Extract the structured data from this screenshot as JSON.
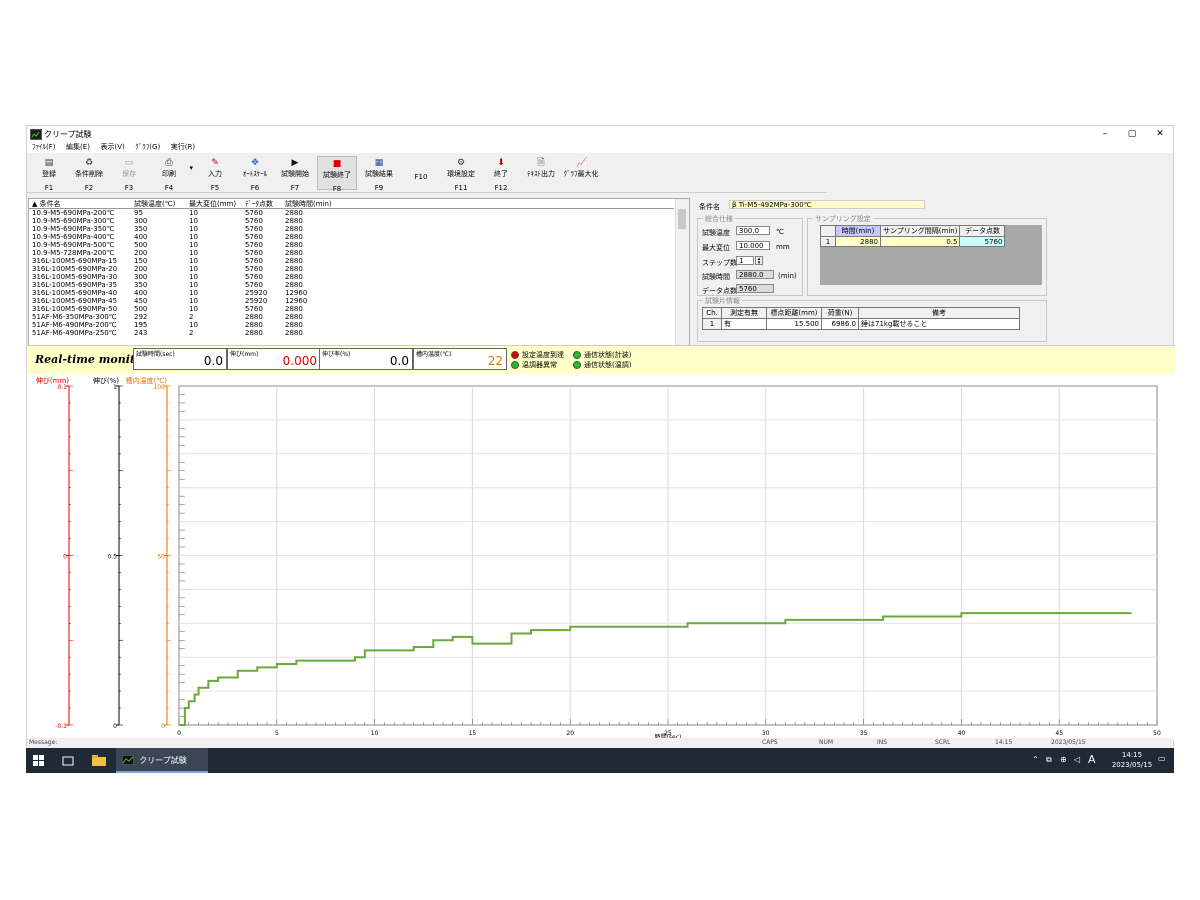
{
  "window": {
    "title": "クリープ試験",
    "minimize": "–",
    "maximize": "▢",
    "close": "✕"
  },
  "menu": [
    "ﾌｧｲﾙ(F)",
    "編集(E)",
    "表示(V)",
    "ｸﾞﾗﾌ(G)",
    "実行(R)"
  ],
  "toolbar": [
    {
      "label": "登録",
      "key": "F1",
      "icon": "register-icon",
      "glyph": "▤",
      "color": "#333333"
    },
    {
      "label": "条件削除",
      "key": "F2",
      "icon": "delete-icon",
      "glyph": "♻",
      "color": "#444444"
    },
    {
      "label": "保存",
      "key": "F3",
      "icon": "save-icon",
      "glyph": "▭",
      "color": "#999999",
      "disabled": true
    },
    {
      "label": "印刷",
      "key": "F4",
      "icon": "print-icon",
      "glyph": "⎙",
      "color": "#333333",
      "dropdown": true
    },
    {
      "label": "入力",
      "key": "F5",
      "icon": "pen-icon",
      "glyph": "✎",
      "color": "#c00000"
    },
    {
      "label": "ｵｰﾄｽｹｰﾙ",
      "key": "F6",
      "icon": "autoscale-icon",
      "glyph": "✥",
      "color": "#2060c0"
    },
    {
      "label": "試験開始",
      "key": "F7",
      "icon": "play-icon",
      "glyph": "▶",
      "color": "#111111"
    },
    {
      "label": "試験終了",
      "key": "F8",
      "icon": "stop-icon",
      "glyph": "■",
      "color": "#e00000",
      "active": true
    },
    {
      "label": "試験結果",
      "key": "F9",
      "icon": "results-icon",
      "glyph": "▦",
      "color": "#2050a0"
    },
    {
      "label": "",
      "key": "F10",
      "icon": "",
      "glyph": "",
      "color": "#333333"
    },
    {
      "label": "環境設定",
      "key": "F11",
      "icon": "settings-icon",
      "glyph": "⚙",
      "color": "#333333"
    },
    {
      "label": "終了",
      "key": "F12",
      "icon": "exit-icon",
      "glyph": "⬇",
      "color": "#b00000"
    },
    {
      "label": "ﾃｷｽﾄ出力",
      "key": "",
      "icon": "text-output-icon",
      "glyph": "🗎",
      "color": "#333333"
    },
    {
      "label": "ｸﾞﾗﾌ最大化",
      "key": "",
      "icon": "graph-max-icon",
      "glyph": "📈",
      "color": "#333333"
    }
  ],
  "list": {
    "headers": [
      "▲ 条件名",
      "試験温度(℃)",
      "最大変位(mm)",
      "ﾃﾞｰﾀ点数",
      "試験時間(min)"
    ],
    "rows": [
      [
        "10.9-M5-690MPa-200℃",
        "95",
        "10",
        "5760",
        "2880"
      ],
      [
        "10.9-M5-690MPa-300℃",
        "300",
        "10",
        "5760",
        "2880"
      ],
      [
        "10.9-M5-690MPa-350℃",
        "350",
        "10",
        "5760",
        "2880"
      ],
      [
        "10.9-M5-690MPa-400℃",
        "400",
        "10",
        "5760",
        "2880"
      ],
      [
        "10.9-M5-690MPa-500℃",
        "500",
        "10",
        "5760",
        "2880"
      ],
      [
        "10.9-M5-728MPa-200℃",
        "200",
        "10",
        "5760",
        "2880"
      ],
      [
        "316L-100M5-690MPa-15",
        "150",
        "10",
        "5760",
        "2880"
      ],
      [
        "316L-100M5-690MPa-20",
        "200",
        "10",
        "5760",
        "2880"
      ],
      [
        "316L-100M5-690MPa-30",
        "300",
        "10",
        "5760",
        "2880"
      ],
      [
        "316L-100M5-690MPa-35",
        "350",
        "10",
        "5760",
        "2880"
      ],
      [
        "316L-100M5-690MPa-40",
        "400",
        "10",
        "25920",
        "12960"
      ],
      [
        "316L-100M5-690MPa-45",
        "450",
        "10",
        "25920",
        "12960"
      ],
      [
        "316L-100M5-690MPa-50",
        "500",
        "10",
        "5760",
        "2880"
      ],
      [
        "51AF-M6-350MPa-300℃",
        "292",
        "2",
        "2880",
        "2880"
      ],
      [
        "51AF-M6-490MPa-200℃",
        "195",
        "10",
        "2880",
        "2880"
      ],
      [
        "51AF-M6-490MPa-250℃",
        "243",
        "2",
        "2880",
        "2880"
      ]
    ]
  },
  "condition": {
    "name_label": "条件名",
    "name_value": "β Ti-M5-492MPa-300℃",
    "general_title": "総合仕様",
    "temp_label": "試験温度",
    "temp_value": "300.0",
    "temp_unit": "℃",
    "disp_label": "最大変位",
    "disp_value": "10.000",
    "disp_unit": "mm",
    "steps_label": "ステップ数",
    "steps_value": "1",
    "time_label": "試験時間",
    "time_value": "2880.0",
    "time_unit": "(min)",
    "points_label": "データ点数",
    "points_value": "5760",
    "sampling_title": "サンプリング設定",
    "sampling_headers": [
      "時間(min)",
      "サンプリング間隔(min)",
      "データ点数"
    ],
    "sampling_row": [
      "1",
      "2880",
      "0.5",
      "5760"
    ],
    "specimen_title": "試験片情報",
    "specimen_headers": [
      "Ch.",
      "測定有無",
      "標点距離(mm)",
      "荷重(N)",
      "備考"
    ],
    "specimen_row": [
      "1",
      "有",
      "15.500",
      "6986.0",
      "錘は71kg載せること"
    ]
  },
  "monitor": {
    "title": "Real-time monitor",
    "boxes": [
      {
        "label": "試験時間(sec)",
        "value": "0.0",
        "color": "#000000"
      },
      {
        "label": "伸び(mm)",
        "value": "0.000",
        "color": "#e00000"
      },
      {
        "label": "伸び率(%)",
        "value": "0.0",
        "color": "#000000"
      },
      {
        "label": "槽内温度(℃)",
        "value": "22",
        "color": "#e07000"
      }
    ],
    "status": [
      {
        "label": "設定温度到達",
        "color": "#e00000"
      },
      {
        "label": "温調器異常",
        "color": "#20c020"
      },
      {
        "label": "通信状態(計装)",
        "color": "#20c020"
      },
      {
        "label": "通信状態(温調)",
        "color": "#20c020"
      }
    ]
  },
  "chart_data": {
    "type": "line",
    "xlabel": "時間(sec)",
    "xlim": [
      0,
      50
    ],
    "xticks": [
      "0",
      "5",
      "10",
      "15",
      "20",
      "25",
      "30",
      "35",
      "40",
      "45",
      "50"
    ],
    "axes": [
      {
        "label": "伸び(mm)",
        "color": "#e00000",
        "ticks": [
          "0.1",
          "0",
          "-0.1"
        ]
      },
      {
        "label": "伸び(%)",
        "color": "#000000",
        "ticks": [
          "1",
          "0.5",
          "0"
        ]
      },
      {
        "label": "槽内温度(℃)",
        "color": "#e07000",
        "ticks": [
          "100",
          "50",
          "0"
        ]
      }
    ],
    "ylim": [
      0,
      100
    ],
    "grid": true,
    "series": [
      {
        "color": "#6aaa3a",
        "x": [
          0,
          0.3,
          0.5,
          0.8,
          1.0,
          1.5,
          2.0,
          3.0,
          4.0,
          5.0,
          6.0,
          7.0,
          9.0,
          9.5,
          12.0,
          13.0,
          14.0,
          15.0,
          16.0,
          17.0,
          18.0,
          20.0,
          25.0,
          26.0,
          30.0,
          31.0,
          35.0,
          36.0,
          40.0,
          42.0,
          45.0,
          48.7
        ],
        "y": [
          0,
          5,
          7,
          9,
          11,
          13,
          14,
          16,
          17,
          18,
          19,
          19,
          20,
          22,
          23,
          25,
          26,
          24,
          24,
          27,
          28,
          29,
          29,
          30,
          30,
          31,
          31,
          32,
          33,
          33,
          33,
          33
        ]
      }
    ]
  },
  "statusbar": {
    "message": "Message:",
    "caps": "CAPS",
    "num": "NUM",
    "ins": "INS",
    "scrl": "SCRL",
    "time": "14:15",
    "date": "2023/05/15"
  },
  "taskbar": {
    "app_label": "クリープ試験",
    "time": "14:15",
    "date": "2023/05/15",
    "ime": "A"
  }
}
